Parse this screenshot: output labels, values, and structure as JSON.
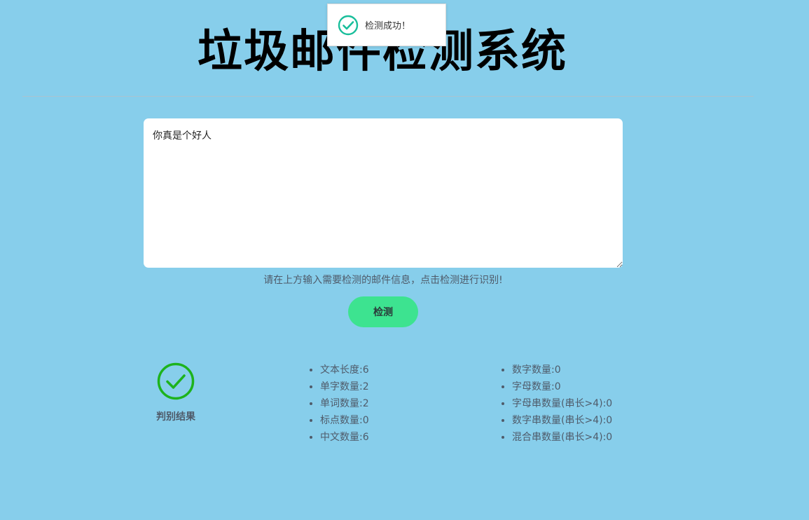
{
  "title": "垃圾邮件检测系统",
  "toast": {
    "message": "检测成功！",
    "icon": "check-circle-icon",
    "color": "#19be9b"
  },
  "input": {
    "value": "你真是个好人"
  },
  "hint": "请在上方输入需要检测的邮件信息，点击检测进行识别!",
  "detect_button": {
    "label": "检测",
    "color": "#3de390"
  },
  "result": {
    "icon": "check-circle-icon",
    "icon_color": "#1db31d",
    "label": "判别结果"
  },
  "stats": {
    "left": [
      {
        "label": "文本长度",
        "value": "6"
      },
      {
        "label": "单字数量",
        "value": "2"
      },
      {
        "label": "单词数量",
        "value": "2"
      },
      {
        "label": "标点数量",
        "value": "0"
      },
      {
        "label": "中文数量",
        "value": "6"
      }
    ],
    "right": [
      {
        "label": "数字数量",
        "value": "0"
      },
      {
        "label": "字母数量",
        "value": "0"
      },
      {
        "label": "字母串数量(串长>4)",
        "value": "0"
      },
      {
        "label": "数字串数量(串长>4)",
        "value": "0"
      },
      {
        "label": "混合串数量(串长>4)",
        "value": "0"
      }
    ]
  },
  "colors": {
    "background": "#87ceeb",
    "text": "#4f5b6a"
  }
}
